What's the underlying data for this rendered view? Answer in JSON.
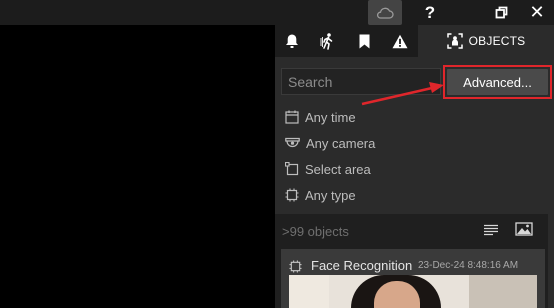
{
  "titlebar": {
    "cloud_icon": "cloud-icon",
    "help_label": "?",
    "restore_icon": "restore-icon",
    "close_label": "✕"
  },
  "tabs": {
    "items": [
      {
        "icon": "bell-icon"
      },
      {
        "icon": "motion-person-icon"
      },
      {
        "icon": "bookmark-icon"
      },
      {
        "icon": "warning-icon"
      }
    ],
    "active": {
      "icon": "person-focus-icon",
      "label": "OBJECTS"
    }
  },
  "search": {
    "placeholder": "Search",
    "value": ""
  },
  "advanced_button": {
    "label": "Advanced..."
  },
  "filters": [
    {
      "icon": "calendar-icon",
      "label": "Any time"
    },
    {
      "icon": "camera-icon",
      "label": "Any camera"
    },
    {
      "icon": "select-area-icon",
      "label": "Select area"
    },
    {
      "icon": "chip-icon",
      "label": "Any type"
    }
  ],
  "results": {
    "count": ">99 objects",
    "view_list_icon": "list-view-icon",
    "view_grid_icon": "thumbnail-view-icon",
    "cards": [
      {
        "icon": "chip-icon",
        "title": "Face Recognition",
        "timestamp": "23-Dec-24 8:48:16 AM"
      }
    ]
  },
  "colors": {
    "panel_bg": "#2b2b2b",
    "titlebar_bg": "#1c1c1c",
    "highlight_red": "#e0262b",
    "button_bg": "#4a4a4a"
  }
}
